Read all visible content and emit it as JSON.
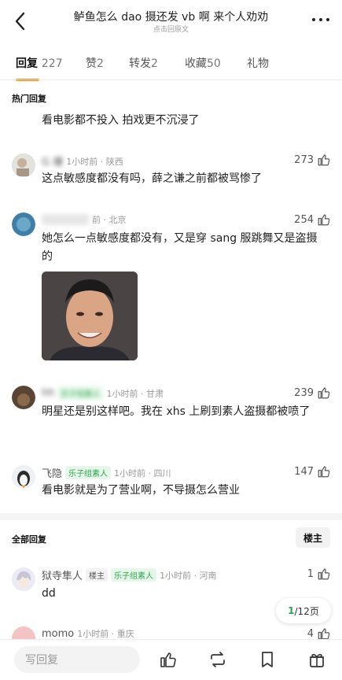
{
  "header": {
    "title": "鲈鱼怎么 dao 摄还发 vb 啊 来个人劝劝",
    "subtitle": "点击回原文"
  },
  "tabs": [
    {
      "label": "回复",
      "count": "227",
      "active": true
    },
    {
      "label": "赞",
      "count": "2"
    },
    {
      "label": "转发",
      "count": "2"
    },
    {
      "label": "收藏",
      "count": "50"
    },
    {
      "label": "礼物",
      "count": ""
    }
  ],
  "hot": {
    "label": "热门回复",
    "partial_text": "看电影都不投入 拍戏更不沉浸了",
    "comments": [
      {
        "user": "G 爆",
        "time": "1小时前 · 陕西",
        "text": "这点敏感度都没有吗，薛之谦之前都被骂惨了",
        "likes": "273"
      },
      {
        "user": "",
        "time": "前 · 北京",
        "text": "她怎么一点敏感度都没有，又是穿 sang 服跳舞又是盗摄的",
        "likes": "254"
      },
      {
        "user": "hh",
        "badge": "乐子组素人",
        "time": "1小时前 · 甘肃",
        "text": "明星还是别这样吧。我在 xhs 上刷到素人盗摄都被喷了",
        "likes": "239"
      },
      {
        "user": "飞隐",
        "badge": "乐子组素人",
        "time": "1小时前 · 四川",
        "text": "看电影就是为了营业啊，不导摄怎么营业",
        "likes": "147"
      }
    ]
  },
  "all": {
    "label": "全部回复",
    "owner_button": "楼主",
    "comments": [
      {
        "user": "狱寺隼人",
        "owner_badge": "楼主",
        "badge": "乐子组素人",
        "time": "1小时前 · 河南",
        "text": "dd",
        "likes": "1"
      },
      {
        "user": "momo",
        "time": "1小时前 · 重庆",
        "text": "",
        "likes": "4"
      }
    ]
  },
  "pager": {
    "current": "1",
    "total": "/12页"
  },
  "bottom": {
    "reply_placeholder": "写回复"
  },
  "colors": {
    "accent": "#ff8200",
    "badge_green": "#2aa54d"
  },
  "icons": [
    "back-icon",
    "more-icon",
    "thumb-up-icon",
    "repost-icon",
    "bookmark-icon",
    "gift-icon"
  ]
}
